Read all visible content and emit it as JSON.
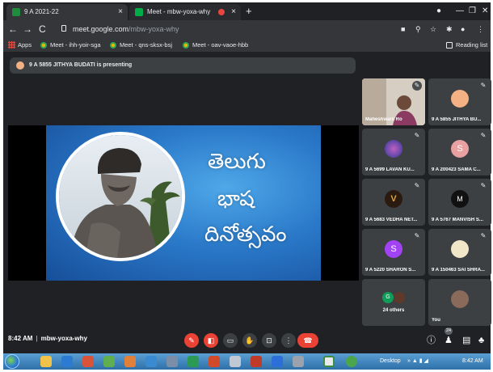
{
  "browser": {
    "tabs": [
      {
        "title": "9 A 2021-22",
        "icon": "classroom-icon",
        "color": "#1e8e3e"
      },
      {
        "title": "Meet - mbw-yoxa-why",
        "icon": "meet-icon",
        "color": "#00ac47",
        "recording": true
      }
    ],
    "url_host": "meet.google.com",
    "url_path": "/mbw-yoxa-why",
    "bookmarks": [
      {
        "label": "Apps",
        "icon": "apps-grid-icon"
      },
      {
        "label": "Meet - ihh-yoir-sga",
        "icon": "meet-icon"
      },
      {
        "label": "Meet - qns-sksx-bsj",
        "icon": "meet-icon"
      },
      {
        "label": "Meet - oav-vaoe-hbb",
        "icon": "meet-icon"
      }
    ],
    "reading_list": "Reading list"
  },
  "meet": {
    "presenting_text": "9 A 5855 JITHYA BUDATI is presenting",
    "slide": {
      "lines": [
        "తెలుగు",
        "భాష",
        "దినోత్సవం"
      ]
    },
    "participants": [
      {
        "name": "Maheshwarii Ro",
        "type": "video",
        "bg": "#c9b9a8"
      },
      {
        "name": "9 A 5855 JITHYA BU...",
        "type": "avatar",
        "color": "#f4b184",
        "letter": ""
      },
      {
        "name": "9 A 5699 LAVAN KU...",
        "type": "avatar",
        "color": "#3b5bb5",
        "letter": ""
      },
      {
        "name": "9 A 200423 SAMA C...",
        "type": "avatar",
        "color": "#e8a0a0",
        "letter": "S"
      },
      {
        "name": "9 A 5683 VEDHA NET...",
        "type": "avatar",
        "color": "#2b1a10",
        "letter": "V"
      },
      {
        "name": "9 A 5767 MANVISH S...",
        "type": "avatar",
        "color": "#111111",
        "letter": "M"
      },
      {
        "name": "9 A 5220 SHARON S...",
        "type": "avatar",
        "color": "#a142f4",
        "letter": "S"
      },
      {
        "name": "9 A 150463 SAI SHRA...",
        "type": "avatar",
        "color": "#f2e6c8",
        "letter": ""
      },
      {
        "name": "24 others",
        "type": "others"
      },
      {
        "name": "You",
        "type": "avatar",
        "color": "#8a6a5a",
        "letter": ""
      }
    ],
    "others_letter": "G",
    "time": "8:42 AM",
    "meeting_code": "mbw-yoxa-why",
    "participant_count": "24"
  },
  "taskbar": {
    "desktop_label": "Desktop",
    "clock": "8:42 AM"
  }
}
